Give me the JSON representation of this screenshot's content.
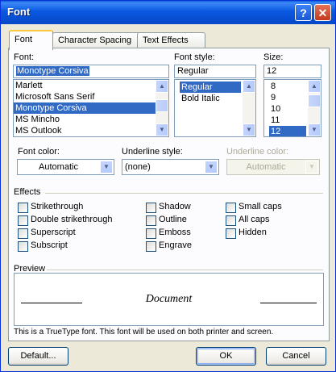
{
  "window": {
    "title": "Font",
    "help_label": "?",
    "close_label": "✕"
  },
  "tabs": [
    {
      "label": "Font",
      "u": "n"
    },
    {
      "label": "Character Spacing",
      "u": "r"
    },
    {
      "label": "Text Effects",
      "u": "x"
    }
  ],
  "font": {
    "label": "Font:",
    "value": "Monotype Corsiva",
    "items": [
      "Marlett",
      "Microsoft Sans Serif",
      "Monotype Corsiva",
      "MS Mincho",
      "MS Outlook"
    ],
    "selected_index": 2
  },
  "font_style": {
    "label": "Font style:",
    "value": "Regular",
    "items": [
      "Regular",
      "Bold Italic"
    ],
    "selected_index": 0
  },
  "size": {
    "label": "Size:",
    "value": "12",
    "items": [
      "8",
      "9",
      "10",
      "11",
      "12"
    ],
    "selected_index": 4
  },
  "font_color": {
    "label": "Font color:",
    "value": "Automatic"
  },
  "underline_style": {
    "label": "Underline style:",
    "value": "(none)"
  },
  "underline_color": {
    "label": "Underline color:",
    "value": "Automatic",
    "disabled": true
  },
  "effects": {
    "label": "Effects",
    "items": [
      {
        "label": "Strikethrough",
        "checked": false
      },
      {
        "label": "Double strikethrough",
        "checked": false
      },
      {
        "label": "Superscript",
        "checked": false
      },
      {
        "label": "Subscript",
        "checked": false
      },
      {
        "label": "Shadow",
        "checked": false
      },
      {
        "label": "Outline",
        "checked": false
      },
      {
        "label": "Emboss",
        "checked": false
      },
      {
        "label": "Engrave",
        "checked": false
      },
      {
        "label": "Small caps",
        "checked": false
      },
      {
        "label": "All caps",
        "checked": false
      },
      {
        "label": "Hidden",
        "checked": false
      }
    ]
  },
  "preview": {
    "label": "Preview",
    "sample_text": "Document"
  },
  "note": "This is a TrueType font. This font will be used on both printer and screen.",
  "buttons": {
    "default": "Default...",
    "ok": "OK",
    "cancel": "Cancel"
  },
  "icons": {
    "scroll_up": "scroll-up-arrow",
    "scroll_down": "scroll-down-arrow",
    "dropdown": "dropdown-arrow"
  },
  "colors": {
    "titlebar": "#0a58e0",
    "selection": "#316ac5",
    "dialog_bg": "#ece9d8"
  }
}
